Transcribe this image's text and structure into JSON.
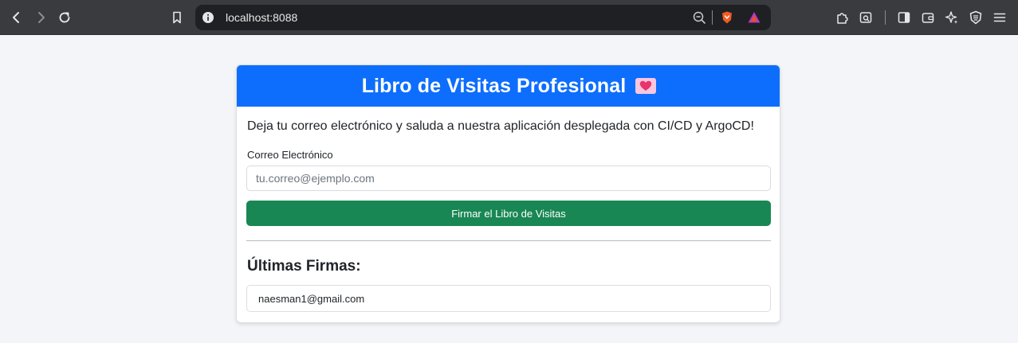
{
  "browser": {
    "url": "localhost:8088",
    "icons": [
      "back-icon",
      "forward-icon",
      "reload-icon",
      "bookmark-icon",
      "site-info-icon",
      "zoom-icon",
      "brave-shield-icon",
      "brave-rewards-icon",
      "extensions-icon",
      "screenshot-icon",
      "sidebar-icon",
      "wallet-icon",
      "leo-ai-icon",
      "vpn-icon",
      "menu-icon"
    ]
  },
  "card": {
    "title": "Libro de Visitas Profesional",
    "header_color": "#0d6efd",
    "intro": "Deja tu correo electrónico y saluda a nuestra aplicación desplegada con CI/CD y ArgoCD!",
    "form": {
      "email_label": "Correo Electrónico",
      "email_value": "",
      "email_placeholder": "tu.correo@ejemplo.com",
      "submit_label": "Firmar el Libro de Visitas",
      "submit_color": "#198754"
    },
    "signatures": {
      "title": "Últimas Firmas:",
      "items": [
        "naesman1@gmail.com"
      ]
    }
  }
}
